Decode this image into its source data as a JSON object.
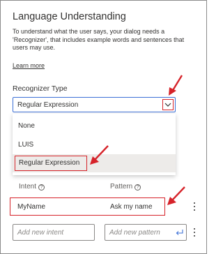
{
  "panel": {
    "title": "Language Understanding",
    "description": "To understand what the user says, your dialog needs a 'Recognizer', that includes example words and sentences that users may use.",
    "learn_more": "Learn more"
  },
  "recognizer": {
    "label": "Recognizer Type",
    "selected": "Regular Expression",
    "options": [
      "None",
      "LUIS",
      "Regular Expression"
    ]
  },
  "table": {
    "headers": {
      "intent": "Intent",
      "pattern": "Pattern"
    },
    "rows": [
      {
        "intent": "MyName",
        "pattern": "Ask my name"
      }
    ]
  },
  "new_row": {
    "intent_placeholder": "Add new intent",
    "pattern_placeholder": "Add new pattern"
  },
  "colors": {
    "highlight_red": "#d6232a",
    "focus_blue": "#3b6fd6",
    "selected_option_bg": "#edebe9"
  }
}
